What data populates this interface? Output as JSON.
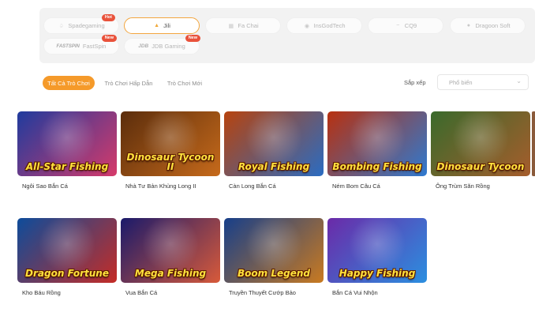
{
  "providers": [
    {
      "name": "Spadegaming",
      "icon": "spade-icon",
      "badge": "Hot",
      "active": false
    },
    {
      "name": "Jili",
      "icon": "jili-logo-icon",
      "badge": "",
      "active": true
    },
    {
      "name": "Fa Chai",
      "icon": "fachai-logo-icon",
      "badge": "",
      "active": false
    },
    {
      "name": "InsGodTech",
      "icon": "eye-logo-icon",
      "badge": "",
      "active": false
    },
    {
      "name": "CQ9",
      "icon": "cq9-logo-icon",
      "badge": "",
      "active": false
    },
    {
      "name": "Dragoon Soft",
      "icon": "dragon-logo-icon",
      "badge": "",
      "active": false
    },
    {
      "name": "FastSpin",
      "icon": "fastspin-logo-icon",
      "badge": "New",
      "active": false,
      "logo_text": "FASTSPIN"
    },
    {
      "name": "JDB Gaming",
      "icon": "jdb-logo-icon",
      "badge": "New",
      "active": false,
      "logo_text": "JDB"
    }
  ],
  "filters": {
    "tabs": [
      "Tất Cả Trò Chơi",
      "Trò Chơi Hấp Dẫn",
      "Trò Chơi Mới"
    ],
    "active_tab": 0,
    "sort_label": "Sắp xếp",
    "sort_value": "Phổ biến"
  },
  "games": [
    {
      "name": "Ngôi Sao Bắn Cá",
      "title_art": "All-Star Fishing",
      "colors": [
        "#1f3b9e",
        "#d63a6a"
      ]
    },
    {
      "name": "Nhà Tư Bản Khủng Long II",
      "title_art": "Dinosaur Tycoon II",
      "colors": [
        "#5b2d0c",
        "#c66a1b"
      ]
    },
    {
      "name": "Càn Long Bắn Cá",
      "title_art": "Royal Fishing",
      "colors": [
        "#b7430e",
        "#2a6cc2"
      ]
    },
    {
      "name": "Ném Bom Câu Cá",
      "title_art": "Bombing Fishing",
      "colors": [
        "#b8300f",
        "#2e7ad1"
      ]
    },
    {
      "name": "Ông Trùm Săn Rồng",
      "title_art": "Dinosaur Tycoon",
      "colors": [
        "#3a6a2c",
        "#a65d2c"
      ]
    },
    {
      "name": "Kho Báu Rồng",
      "title_art": "Dragon Fortune",
      "colors": [
        "#0d4c9b",
        "#c52c26"
      ]
    },
    {
      "name": "Vua Bắn Cá",
      "title_art": "Mega Fishing",
      "colors": [
        "#1a1a6b",
        "#d85a3a"
      ]
    },
    {
      "name": "Truyền Thuyết Cướp Bảo",
      "title_art": "Boom Legend",
      "colors": [
        "#173f8a",
        "#c97a20"
      ]
    },
    {
      "name": "Bắn Cá Vui Nhộn",
      "title_art": "Happy Fishing",
      "colors": [
        "#6b2aa8",
        "#2b8fe0"
      ]
    }
  ]
}
